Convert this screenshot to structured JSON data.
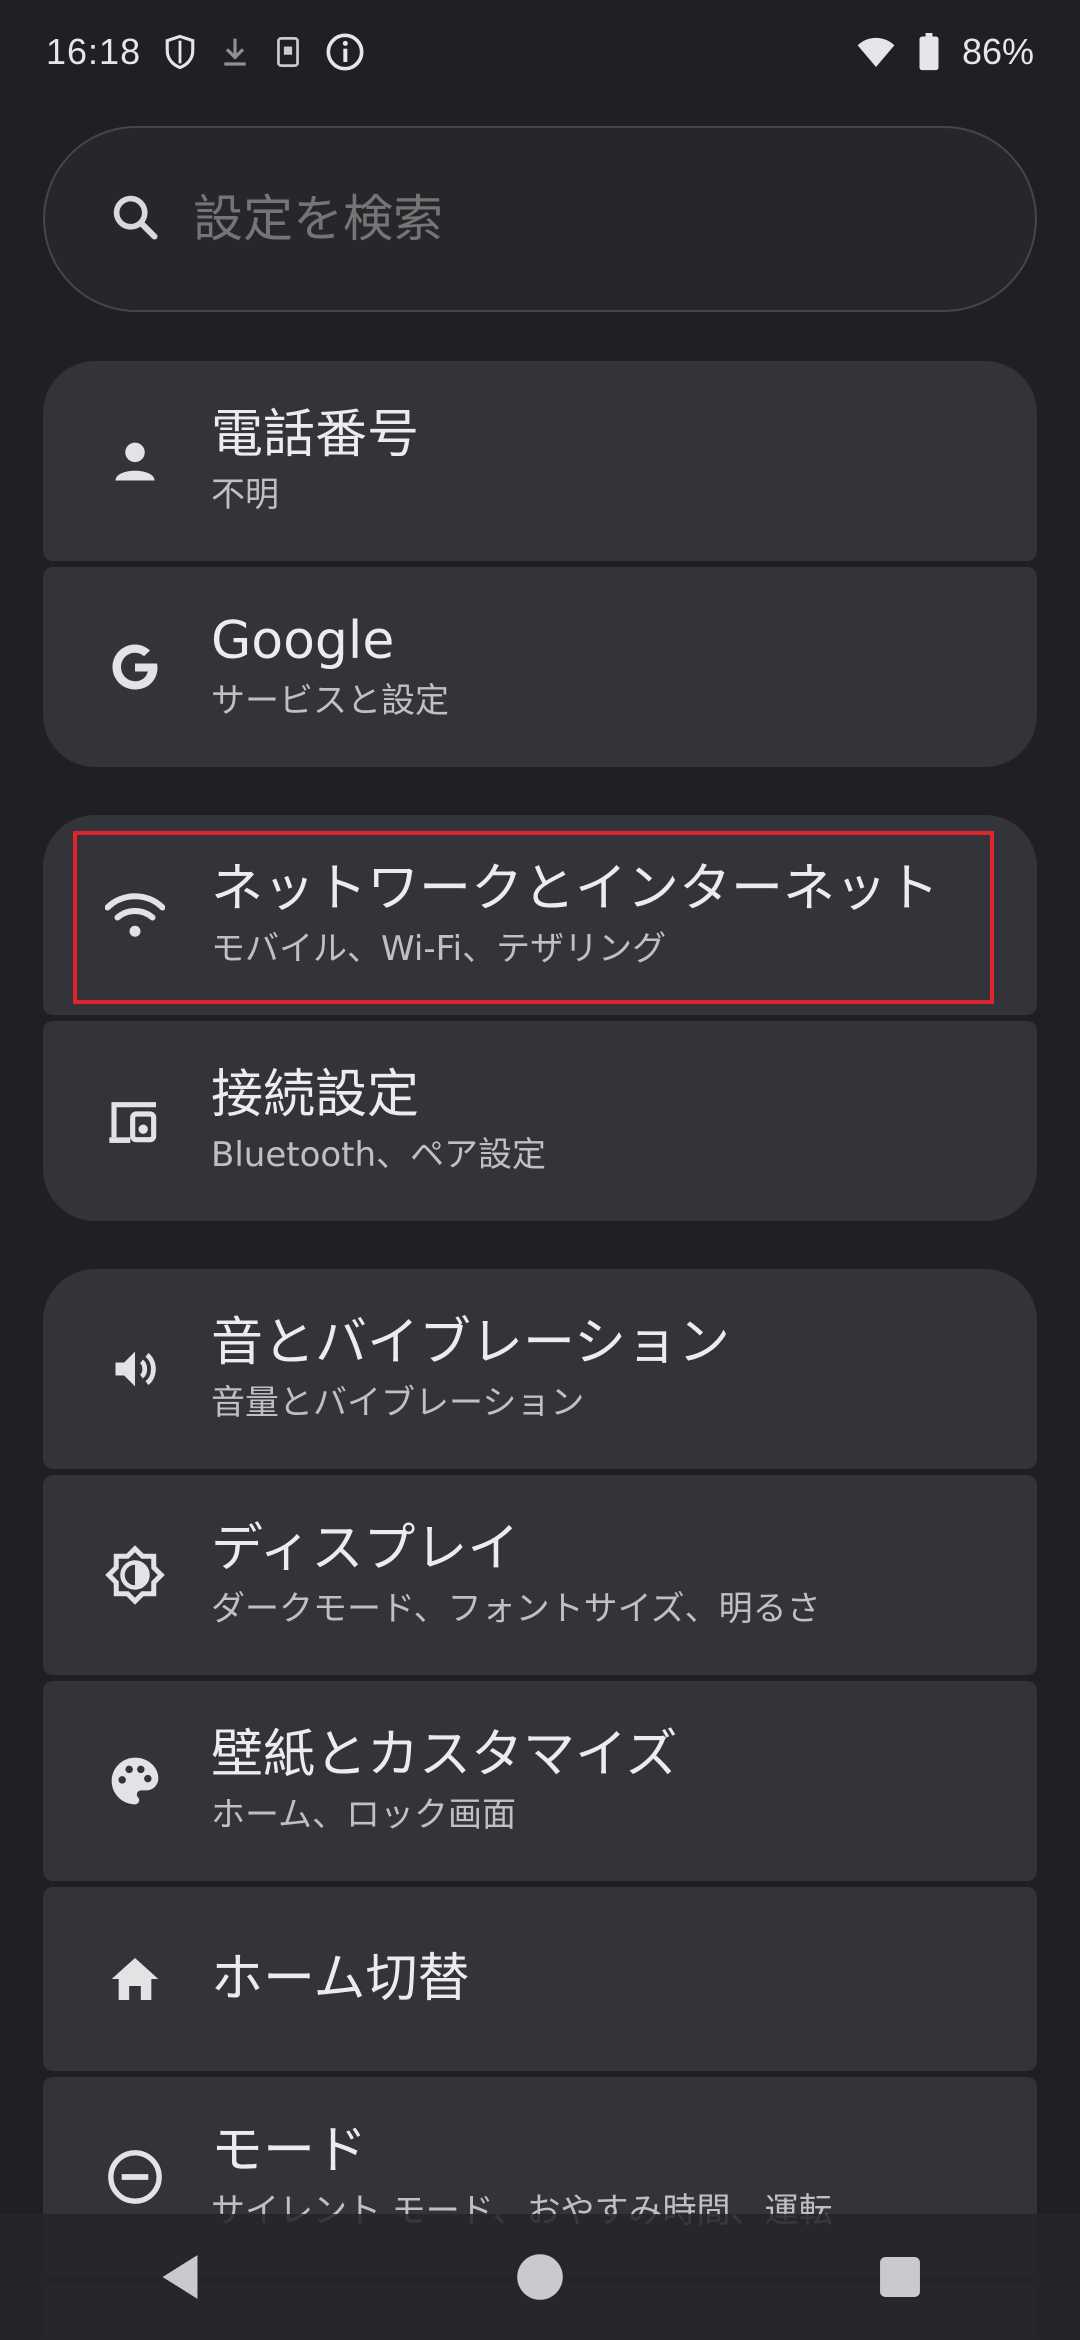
{
  "status_bar": {
    "time": "16:18",
    "battery_percent": "86%",
    "icons": [
      "shield-icon",
      "download-icon",
      "sim-icon",
      "info-icon",
      "wifi-icon",
      "battery-icon"
    ]
  },
  "search": {
    "placeholder": "設定を検索"
  },
  "items": [
    {
      "id": "phone-number",
      "icon": "person-icon",
      "title": "電話番号",
      "subtitle": "不明"
    },
    {
      "id": "google",
      "icon": "google-icon",
      "title": "Google",
      "subtitle": "サービスと設定"
    },
    {
      "id": "network",
      "icon": "wifi-icon",
      "title": "ネットワークとインターネット",
      "subtitle": "モバイル、Wi-Fi、テザリング",
      "highlighted": true
    },
    {
      "id": "connected-devices",
      "icon": "devices-icon",
      "title": "接続設定",
      "subtitle": "Bluetooth、ペア設定"
    },
    {
      "id": "sound",
      "icon": "volume-icon",
      "title": "音とバイブレーション",
      "subtitle": "音量とバイブレーション"
    },
    {
      "id": "display",
      "icon": "brightness-icon",
      "title": "ディスプレイ",
      "subtitle": "ダークモード、フォントサイズ、明るさ"
    },
    {
      "id": "wallpaper",
      "icon": "palette-icon",
      "title": "壁紙とカスタマイズ",
      "subtitle": "ホーム、ロック画面"
    },
    {
      "id": "home-switch",
      "icon": "home-icon",
      "title": "ホーム切替",
      "subtitle": ""
    },
    {
      "id": "modes",
      "icon": "minus-circle-icon",
      "title": "モード",
      "subtitle": "サイレント モード、おやすみ時間、運転"
    }
  ],
  "nav_bar": {
    "icons": [
      "back-icon",
      "home-circle-icon",
      "recents-icon"
    ]
  },
  "colors": {
    "background": "#1f2024",
    "card": "#333439",
    "highlight": "#e0242b"
  }
}
